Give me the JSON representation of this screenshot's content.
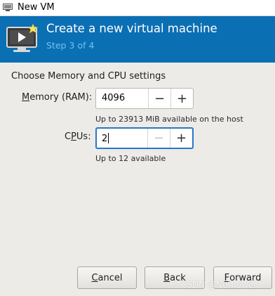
{
  "window": {
    "title": "New VM"
  },
  "banner": {
    "heading": "Create a new virtual machine",
    "step": "Step 3 of 4"
  },
  "form": {
    "section_label": "Choose Memory and CPU settings",
    "memory": {
      "label_mnemonic": "M",
      "label_rest": "emory (RAM):",
      "value": "4096",
      "hint": "Up to 23913 MiB available on the host"
    },
    "cpus": {
      "label_pre": "C",
      "label_mnemonic": "P",
      "label_rest": "Us:",
      "value": "2",
      "hint": "Up to 12 available"
    },
    "decrement_glyph": "−",
    "increment_glyph": "+"
  },
  "buttons": {
    "cancel": {
      "mnemonic": "C",
      "rest": "ancel"
    },
    "back": {
      "mnemonic": "B",
      "rest": "ack"
    },
    "forward": {
      "mnemonic": "F",
      "rest": "orward"
    }
  },
  "watermark": "CSDN @Netflower",
  "colors": {
    "banner": "#0b6fb4",
    "step_text": "#6ec3f2",
    "focus_ring": "#2a76c6"
  }
}
